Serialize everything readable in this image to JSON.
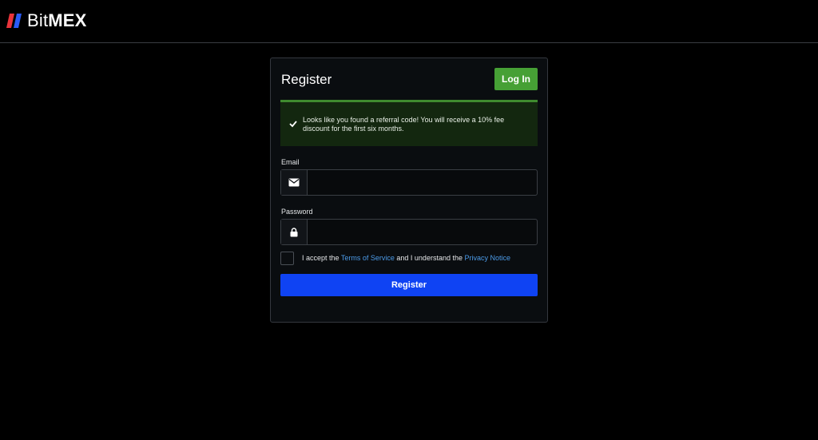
{
  "brand": {
    "name_light": "Bit",
    "name_bold": "MEX",
    "logo_colors": {
      "red": "#e9343b",
      "blue": "#2a5bf6"
    }
  },
  "card": {
    "title": "Register",
    "login_button": "Log In"
  },
  "alert": {
    "icon": "check-icon",
    "message": "Looks like you found a referral code! You will receive a 10% fee discount for the first six months."
  },
  "form": {
    "email": {
      "label": "Email",
      "icon": "envelope-icon",
      "value": "",
      "placeholder": ""
    },
    "password": {
      "label": "Password",
      "icon": "lock-icon",
      "value": "",
      "placeholder": ""
    },
    "terms": {
      "checked": false,
      "text_1": "I accept the ",
      "terms_link": "Terms of Service",
      "text_2": " and I understand the ",
      "privacy_link": "Privacy Notice"
    },
    "submit_label": "Register"
  },
  "colors": {
    "background": "#000000",
    "card": "#0a0d10",
    "success": "#46a035",
    "primary": "#0f43f3",
    "link": "#4c9be8"
  }
}
